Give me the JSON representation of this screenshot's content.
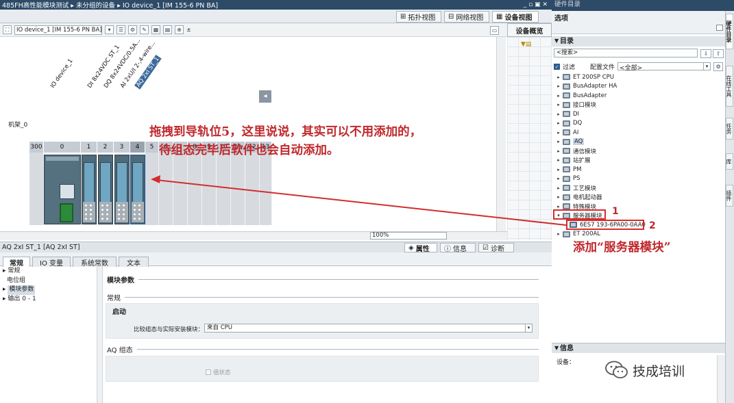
{
  "titlebar": {
    "breadcrumb": "485FH高性能模块测试 ▸ 未分组的设备 ▸ IO device_1 [IM 155-6 PN BA]",
    "controls": "_ ▫ ▣ ✕"
  },
  "view_tabs": {
    "topology": "拓扑视图",
    "network": "网络视图",
    "device": "设备视图"
  },
  "device_select": "IO device_1 [IM 155-6 PN BA]",
  "overview_tab": "设备概览",
  "rack": {
    "label": "机架_0",
    "slots": [
      "300",
      "0",
      "1",
      "2",
      "3",
      "4",
      "5",
      "6",
      "7",
      "8",
      "9",
      "10",
      "11",
      "12",
      "13"
    ],
    "module_labels": [
      "IO device_1",
      "DI 8x24VDC ST_1",
      "DQ 8x24VDC/0.5A...",
      "AI 2xU/I 2-,4-wire...",
      "AQ 2xI ST_1"
    ]
  },
  "zoom": "100%",
  "annotations": {
    "drag_line1": "拖拽到导轨位5，这里说说，其实可以不用添加的，",
    "drag_line2": "待组态完毕后软件也会自动添加。",
    "add_server": "添加“服务器模块”",
    "step1": "1",
    "step2": "2"
  },
  "inspector": {
    "title": "AQ 2xI ST_1 [AQ 2xI ST]",
    "tabs": {
      "properties": "属性",
      "info": "信息",
      "diagnostics": "诊断"
    },
    "subtabs": [
      "常规",
      "IO 变量",
      "系统常数",
      "文本"
    ],
    "nav": [
      "常规",
      "电位组",
      "模块参数",
      "输出 0 - 1"
    ],
    "section_module_params": "模块参数",
    "section_general": "常规",
    "startup_label": "启动",
    "compare_label": "比较组态与实际安装模块：",
    "compare_value": "来自 CPU",
    "aq_config": "AQ 组态",
    "value_status": "值状态"
  },
  "catalog": {
    "window_title": "硬件目录",
    "options": "选项",
    "catalog_head": "目录",
    "search_placeholder": "<搜索>",
    "filter": "过滤",
    "profile_label": "配置文件",
    "profile_value": "<全部>",
    "items": [
      "ET 200SP CPU",
      "BusAdapter HA",
      "BusAdapter",
      "接口模块",
      "DI",
      "DQ",
      "AI",
      "AQ",
      "通信模块",
      "站扩展",
      "PM",
      "PS",
      "工艺模块",
      "电机起动器",
      "特殊模块",
      "服务器模块",
      "6ES7 193-6PA00-0AA0",
      "ET 200AL"
    ],
    "side_tabs": [
      "硬件目录",
      "在线工具",
      "任务",
      "库",
      "插件"
    ],
    "info_head": "信息",
    "device_label": "设备："
  },
  "watermark": "技成培训",
  "colors": {
    "accent": "#c0282c",
    "titlebar": "#2d4a66"
  }
}
